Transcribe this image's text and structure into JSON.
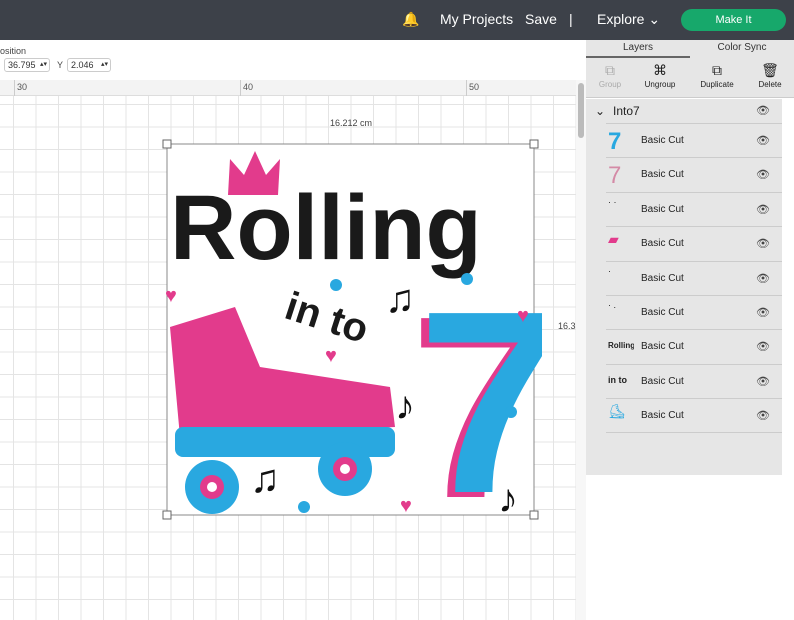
{
  "topbar": {
    "my_projects": "My Projects",
    "save": "Save",
    "divider": "|",
    "explore": "Explore",
    "make_it": "Make It"
  },
  "toolbar": {
    "position_label": "osition",
    "x_value": "36.795",
    "y_label": "Y",
    "y_value": "2.046"
  },
  "ruler": {
    "ticks": [
      "30",
      "40",
      "50"
    ]
  },
  "canvas": {
    "width_label": "16.212 cm",
    "height_label": "16.3"
  },
  "artwork": {
    "line1": "Rolling",
    "line2": "in to",
    "numeral": "7"
  },
  "panel": {
    "tabs": [
      "Layers",
      "Color Sync"
    ],
    "actions": [
      {
        "label": "Group",
        "icon": "group-icon"
      },
      {
        "label": "Ungroup",
        "icon": "ungroup-icon"
      },
      {
        "label": "Duplicate",
        "icon": "duplicate-icon"
      },
      {
        "label": "Delete",
        "icon": "trash-icon"
      }
    ],
    "group_name": "Into7",
    "layers": [
      {
        "name": "Basic Cut",
        "thumb": "7"
      },
      {
        "name": "Basic Cut",
        "thumb": "7"
      },
      {
        "name": "Basic Cut",
        "thumb": ""
      },
      {
        "name": "Basic Cut",
        "thumb": ""
      },
      {
        "name": "Basic Cut",
        "thumb": ""
      },
      {
        "name": "Basic Cut",
        "thumb": ""
      },
      {
        "name": "Basic Cut",
        "thumb": "Rolling"
      },
      {
        "name": "Basic Cut",
        "thumb": "in to"
      },
      {
        "name": "Basic Cut",
        "thumb": ""
      }
    ]
  },
  "colors": {
    "topbar": "#3d4149",
    "accent": "#17a86b",
    "pink": "#e23b8c",
    "blue": "#29a8e0"
  }
}
